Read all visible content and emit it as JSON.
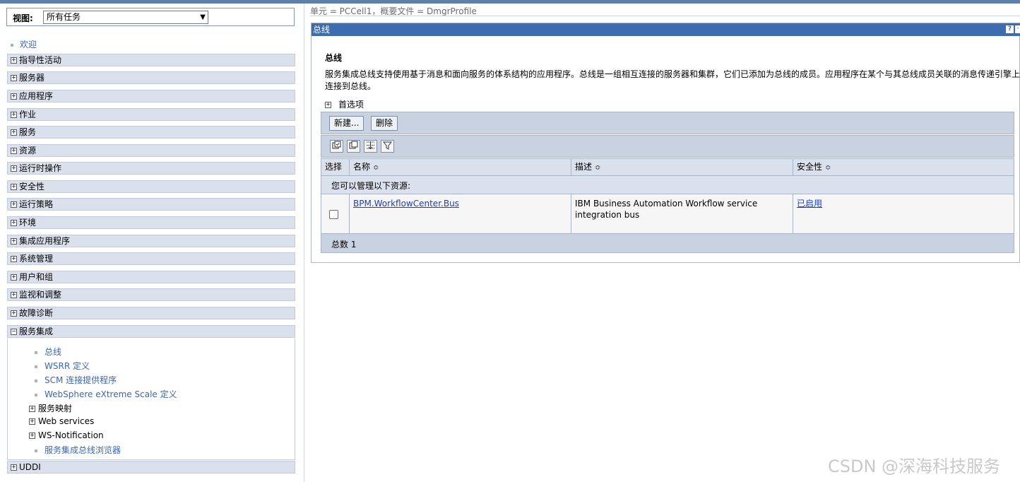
{
  "nav": {
    "view_label": "视图:",
    "view_value": "所有任务",
    "welcome": "欢迎",
    "items": [
      "指导性活动",
      "服务器",
      "应用程序",
      "作业",
      "服务",
      "资源",
      "运行时操作",
      "安全性",
      "运行策略",
      "环境",
      "集成应用程序",
      "系统管理",
      "用户和组",
      "监视和调整",
      "故障诊断"
    ],
    "expanded_item": "服务集成",
    "sub_links": [
      "总线",
      "WSRR 定义",
      "SCM 连接提供程序",
      "WebSphere eXtreme Scale 定义"
    ],
    "sub_groups": [
      "服务映射",
      "Web services",
      "WS-Notification"
    ],
    "sub_last_link": "服务集成总线浏览器",
    "last_item": "UDDI"
  },
  "scope": "单元 = PCCell1，概要文件 = DmgrProfile",
  "panel": {
    "title": "总线",
    "help": "?",
    "minimize": "-",
    "heading": "总线",
    "description": "服务集成总线支持使用基于消息和面向服务的体系结构的应用程序。总线是一组相互连接的服务器和集群，它们已添加为总线的成员。应用程序在某个与其总线成员关联的消息传递引擎上连接到总线。",
    "preferences": "首选项",
    "buttons": {
      "new": "新建...",
      "delete": "删除"
    },
    "columns": {
      "select": "选择",
      "name": "名称",
      "description": "描述",
      "security": "安全性"
    },
    "caption": "您可以管理以下资源:",
    "rows": [
      {
        "name": "BPM.WorkflowCenter.Bus",
        "description": "IBM Business Automation Workflow service integration bus",
        "security": "已启用"
      }
    ],
    "total": "总数 1"
  },
  "watermark": "CSDN @深海科技服务",
  "icons": {
    "expand": "plus-box-icon",
    "collapse": "minus-box-icon",
    "sort": "sort-updown-icon"
  }
}
